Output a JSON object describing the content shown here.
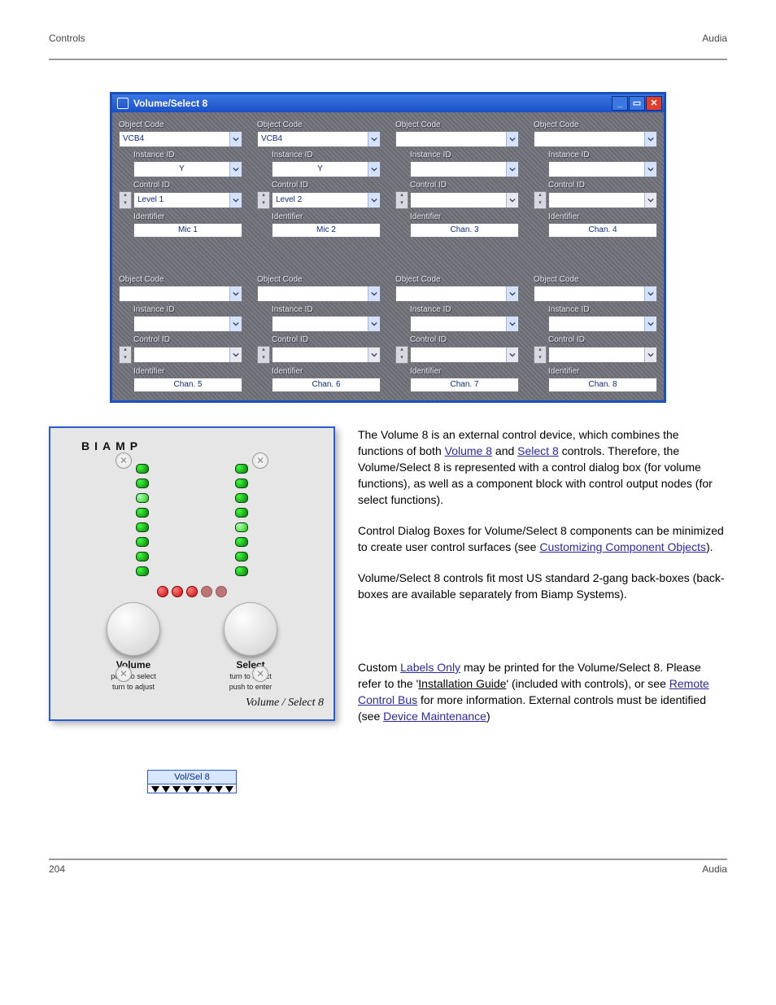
{
  "header": {
    "section": "Controls",
    "product": "Audia"
  },
  "footer": {
    "page": "204",
    "product": "Audia"
  },
  "dialog": {
    "title": "Volume/Select 8",
    "rows": [
      [
        {
          "object_code": "VCB4",
          "instance_id": "Y",
          "control_id": "Level 1",
          "control_enabled": true,
          "identifier": "Mic 1"
        },
        {
          "object_code": "VCB4",
          "instance_id": "Y",
          "control_id": "Level 2",
          "control_enabled": true,
          "identifier": "Mic 2"
        },
        {
          "object_code": "",
          "instance_id": "",
          "control_id": "",
          "control_enabled": false,
          "identifier": "Chan. 3"
        },
        {
          "object_code": "",
          "instance_id": "",
          "control_id": "",
          "control_enabled": false,
          "identifier": "Chan. 4"
        }
      ],
      [
        {
          "object_code": "",
          "instance_id": "",
          "control_id": "",
          "control_enabled": false,
          "identifier": "Chan. 5"
        },
        {
          "object_code": "",
          "instance_id": "",
          "control_id": "",
          "control_enabled": false,
          "identifier": "Chan. 6"
        },
        {
          "object_code": "",
          "instance_id": "",
          "control_id": "",
          "control_enabled": false,
          "identifier": "Chan. 7"
        },
        {
          "object_code": "",
          "instance_id": "",
          "control_id": "",
          "control_enabled": false,
          "identifier": "Chan. 8"
        }
      ]
    ],
    "labels": {
      "object_code": "Object Code",
      "instance_id": "Instance ID",
      "control_id": "Control ID",
      "identifier": "Identifier"
    }
  },
  "biamp_panel": {
    "logo": "BIAMP",
    "knob_left": {
      "label": "Volume",
      "sub1": "push to select",
      "sub2": "turn to adjust"
    },
    "knob_right": {
      "label": "Select",
      "sub1": "turn to select",
      "sub2": "push to enter"
    },
    "title": "Volume / Select 8"
  },
  "text": {
    "p1a": "The Volume 8 is an external control device, which combines the functions of both ",
    "p1_link1": "Volume 8",
    "p1b": " and ",
    "p1_link2": "Select 8",
    "p1c": " controls. Therefore, the Volume/Select 8 is represented with a control dialog box (for volume functions), as well as a component block with control output nodes (for select functions).",
    "p2a": "Control Dialog Boxes for Volume/Select 8 components can be minimized to create user control surfaces (see ",
    "p2_link": "Customizing Component Objects",
    "p2b": ").",
    "p3": "Volume/Select 8 controls fit most US standard 2-gang back-boxes (back-boxes are available separately from Biamp Systems).",
    "p4a": "Custom ",
    "p4_link1": "Labels Only",
    "p4b": " may be printed for the Volume/Select 8. Please refer to the '",
    "p4_u": "Installation Guide",
    "p4c": "' (included with controls), or see ",
    "p4_link2": "Remote Control Bus",
    "p4d": " for more information. External controls must be identified (see ",
    "p4_link3": "Device Maintenance",
    "p4e": ")"
  },
  "vs_block": {
    "title": "Vol/Sel 8"
  }
}
